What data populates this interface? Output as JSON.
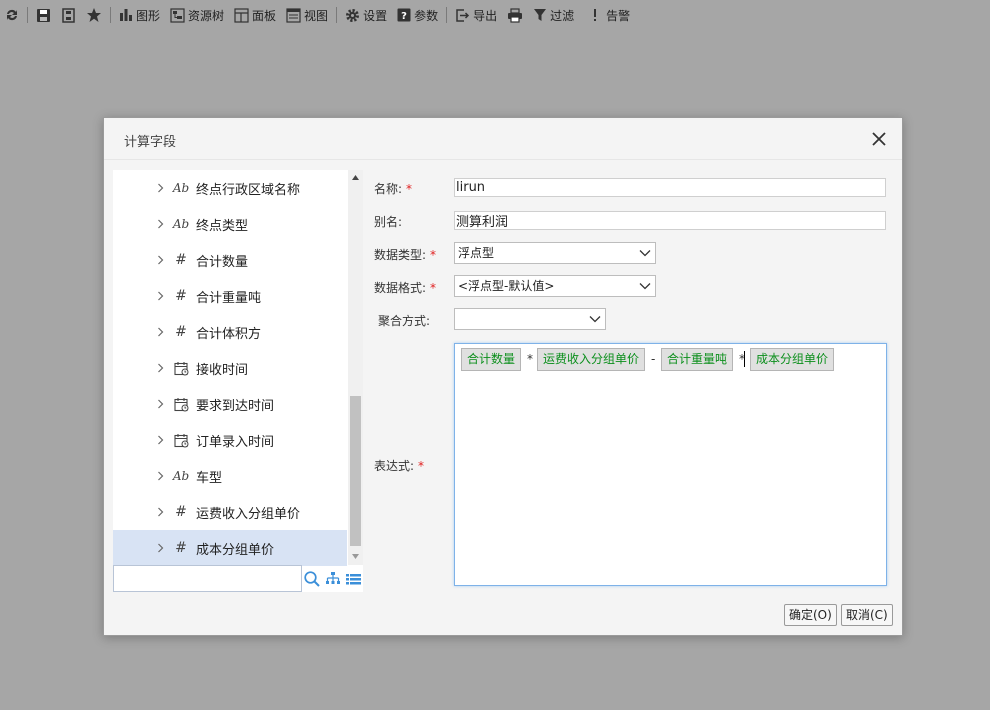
{
  "toolbar": {
    "items": [
      {
        "icon": "refresh-icon",
        "label": ""
      },
      {
        "icon": "save-icon",
        "label": ""
      },
      {
        "icon": "save-as-icon",
        "label": ""
      },
      {
        "icon": "star-icon",
        "label": ""
      },
      {
        "icon": "bar-chart-icon",
        "label": "图形"
      },
      {
        "icon": "resource-tree-icon",
        "label": "资源树"
      },
      {
        "icon": "panel-icon",
        "label": "面板"
      },
      {
        "icon": "view-icon",
        "label": "视图"
      },
      {
        "icon": "gear-icon",
        "label": "设置"
      },
      {
        "icon": "question-icon",
        "label": "参数"
      },
      {
        "icon": "export-icon",
        "label": "导出"
      },
      {
        "icon": "print-icon",
        "label": ""
      },
      {
        "icon": "filter-icon",
        "label": "过滤"
      },
      {
        "icon": "alert-icon",
        "label": "告警"
      }
    ]
  },
  "dialog": {
    "title": "计算字段",
    "tree": {
      "items": [
        {
          "type": "text",
          "icon_text": "Ab",
          "label": "终点行政区域名称"
        },
        {
          "type": "text",
          "icon_text": "Ab",
          "label": "终点类型"
        },
        {
          "type": "number",
          "icon_text": "#",
          "label": "合计数量"
        },
        {
          "type": "number",
          "icon_text": "#",
          "label": "合计重量吨"
        },
        {
          "type": "number",
          "icon_text": "#",
          "label": "合计体积方"
        },
        {
          "type": "date",
          "icon_text": "",
          "label": "接收时间"
        },
        {
          "type": "date",
          "icon_text": "",
          "label": "要求到达时间"
        },
        {
          "type": "date",
          "icon_text": "",
          "label": "订单录入时间"
        },
        {
          "type": "text",
          "icon_text": "Ab",
          "label": "车型"
        },
        {
          "type": "number",
          "icon_text": "#",
          "label": "运费收入分组单价"
        },
        {
          "type": "number",
          "icon_text": "#",
          "label": "成本分组单价",
          "selected": true
        }
      ],
      "search_value": ""
    },
    "form": {
      "name_label": "名称:",
      "name_value": "lirun",
      "alias_label": "别名:",
      "alias_value": "测算利润",
      "datatype_label": "数据类型:",
      "datatype_value": "浮点型",
      "format_label": "数据格式:",
      "format_value": "<浮点型-默认值>",
      "aggregate_label": "聚合方式:",
      "aggregate_value": "",
      "expression_label": "表达式:",
      "required_mark": "*",
      "expression": {
        "f1": "合计数量",
        "op1": "*",
        "f2": "运费收入分组单价",
        "op2": "-",
        "f3": "合计重量吨",
        "op3": "*",
        "f4": "成本分组单价"
      }
    },
    "ok_label": "确定(O)",
    "cancel_label": "取消(C)"
  }
}
